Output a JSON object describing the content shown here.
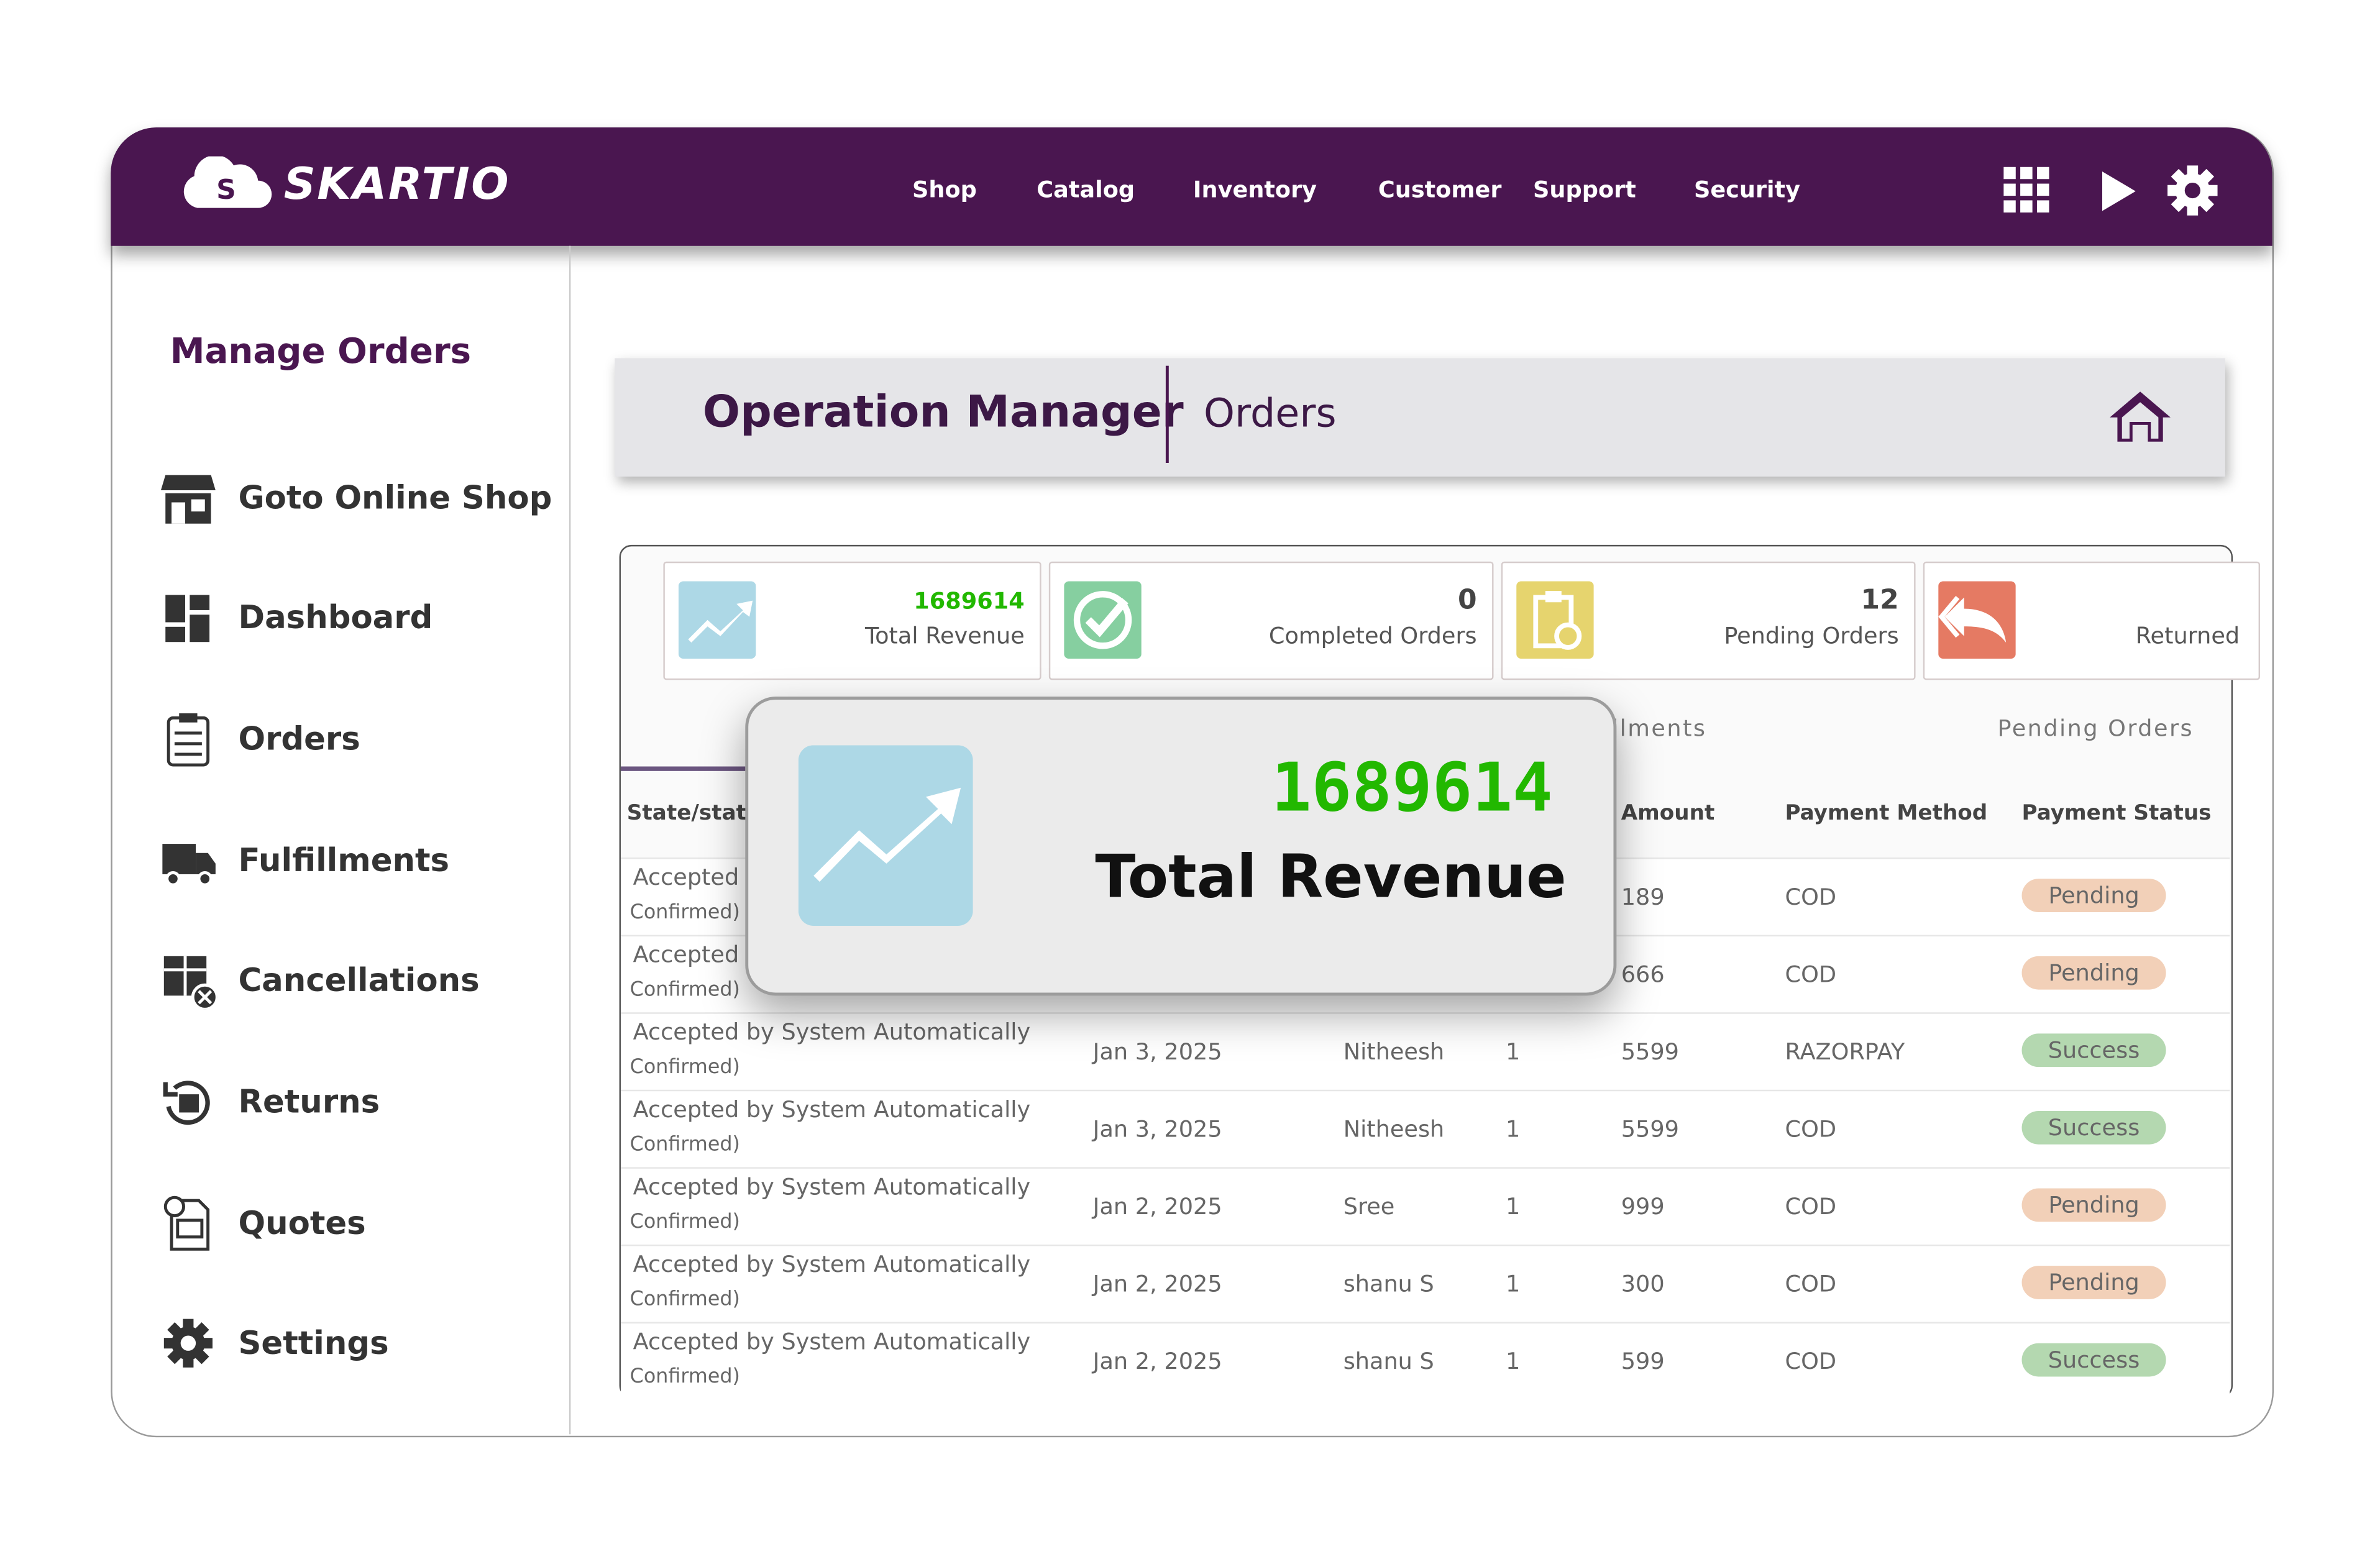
{
  "brand": {
    "name": "SKARTIO",
    "color": "#4a1650"
  },
  "nav": [
    "Shop",
    "Catalog",
    "Inventory",
    "Customer",
    "Support",
    "Security"
  ],
  "top_icons": [
    "grid-icon",
    "play-icon",
    "gear-icon"
  ],
  "sidebar": {
    "heading": "Manage Orders",
    "items": [
      {
        "label": "Goto Online Shop",
        "icon": "store-icon"
      },
      {
        "label": "Dashboard",
        "icon": "dashboard-icon"
      },
      {
        "label": "Orders",
        "icon": "clipboard-icon"
      },
      {
        "label": "Fulfillments",
        "icon": "truck-icon"
      },
      {
        "label": "Cancellations",
        "icon": "box-cancel-icon"
      },
      {
        "label": "Returns",
        "icon": "return-box-icon"
      },
      {
        "label": "Quotes",
        "icon": "quote-doc-icon"
      },
      {
        "label": "Settings",
        "icon": "gear-icon"
      }
    ]
  },
  "titlebar": {
    "title": "Operation Manager",
    "section": "Orders"
  },
  "stats": [
    {
      "value": "1689614",
      "label": "Total Revenue",
      "color": "#add8e6"
    },
    {
      "value": "0",
      "label": "Completed Orders",
      "color": "#86cfa0"
    },
    {
      "value": "12",
      "label": "Pending Orders",
      "color": "#e6d46e"
    },
    {
      "value": "",
      "label": "Returned",
      "color": "#e57a63"
    }
  ],
  "tabs": [
    "llments",
    "Pending Orders"
  ],
  "table": {
    "headers": [
      "State/status",
      "Amount",
      "Payment Method",
      "Payment Status"
    ],
    "rows": [
      {
        "state": "Accepted",
        "sub": "Confirmed)",
        "date": "",
        "customer": "",
        "qty": "",
        "amount": "189",
        "method": "COD",
        "status": "Pending"
      },
      {
        "state": "Accepted",
        "sub": "Confirmed)",
        "date": "",
        "customer": "",
        "qty": "",
        "amount": "666",
        "method": "COD",
        "status": "Pending"
      },
      {
        "state": "Accepted by System Automatically",
        "sub": "Confirmed)",
        "date": "Jan 3, 2025",
        "customer": "Nitheesh",
        "qty": "1",
        "amount": "5599",
        "method": "RAZORPAY",
        "status": "Success"
      },
      {
        "state": "Accepted by System Automatically",
        "sub": "Confirmed)",
        "date": "Jan 3, 2025",
        "customer": "Nitheesh",
        "qty": "1",
        "amount": "5599",
        "method": "COD",
        "status": "Success"
      },
      {
        "state": "Accepted by System Automatically",
        "sub": "Confirmed)",
        "date": "Jan 2, 2025",
        "customer": "Sree",
        "qty": "1",
        "amount": "999",
        "method": "COD",
        "status": "Pending"
      },
      {
        "state": "Accepted by System Automatically",
        "sub": "Confirmed)",
        "date": "Jan 2, 2025",
        "customer": "shanu S",
        "qty": "1",
        "amount": "300",
        "method": "COD",
        "status": "Pending"
      },
      {
        "state": "Accepted by System Automatically",
        "sub": "Confirmed)",
        "date": "Jan 2, 2025",
        "customer": "shanu S",
        "qty": "1",
        "amount": "599",
        "method": "COD",
        "status": "Success"
      }
    ]
  },
  "status_colors": {
    "Pending": "#f2d0b8",
    "Success": "#b4d8b0"
  },
  "popup": {
    "value": "1689614",
    "label": "Total Revenue",
    "value_color": "#22b800"
  }
}
